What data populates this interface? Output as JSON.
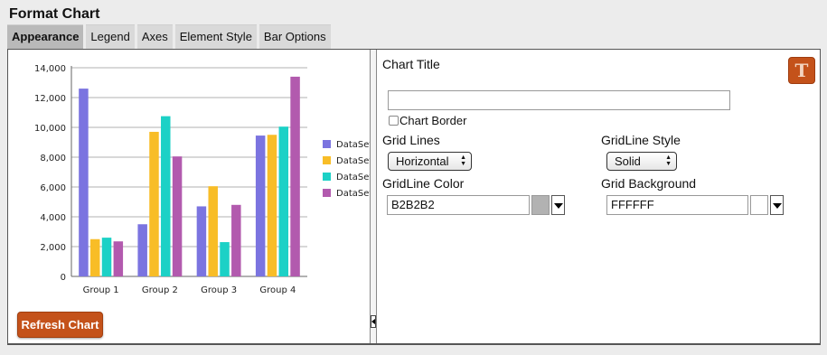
{
  "window": {
    "title": "Format Chart"
  },
  "tabs": [
    {
      "label": "Appearance",
      "active": true
    },
    {
      "label": "Legend"
    },
    {
      "label": "Axes"
    },
    {
      "label": "Element Style"
    },
    {
      "label": "Bar Options"
    }
  ],
  "left": {
    "refresh_label": "Refresh Chart"
  },
  "chart_data": {
    "type": "bar",
    "categories": [
      "Group 1",
      "Group 2",
      "Group 3",
      "Group 4"
    ],
    "series": [
      {
        "name": "DataSet",
        "color": "#7b74e0",
        "values": [
          12600,
          3500,
          4700,
          9450
        ]
      },
      {
        "name": "DataSet",
        "color": "#f8bd27",
        "values": [
          2500,
          9700,
          6050,
          9500
        ]
      },
      {
        "name": "DataSet",
        "color": "#1cd1c6",
        "values": [
          2600,
          10750,
          2300,
          10050
        ]
      },
      {
        "name": "DataSet",
        "color": "#b25aae",
        "values": [
          2350,
          8050,
          4800,
          13400
        ]
      }
    ],
    "ylim": [
      0,
      14000
    ],
    "yticks": [
      "0",
      "2,000",
      "4,000",
      "6,000",
      "8,000",
      "10,000",
      "12,000",
      "14,000"
    ],
    "grid": true,
    "legend_position": "right"
  },
  "form": {
    "chart_title_label": "Chart Title",
    "chart_title_value": "",
    "chart_border_label": "Chart Border",
    "chart_border_checked": false,
    "grid_lines_label": "Grid Lines",
    "grid_lines_value": "Horizontal",
    "gridline_style_label": "GridLine Style",
    "gridline_style_value": "Solid",
    "gridline_color_label": "GridLine Color",
    "gridline_color_value": "B2B2B2",
    "gridline_color_swatch": "#b2b2b2",
    "grid_background_label": "Grid Background",
    "grid_background_value": "FFFFFF",
    "grid_background_swatch": "#ffffff",
    "text_icon": "text-format-icon",
    "text_icon_glyph": "T"
  }
}
